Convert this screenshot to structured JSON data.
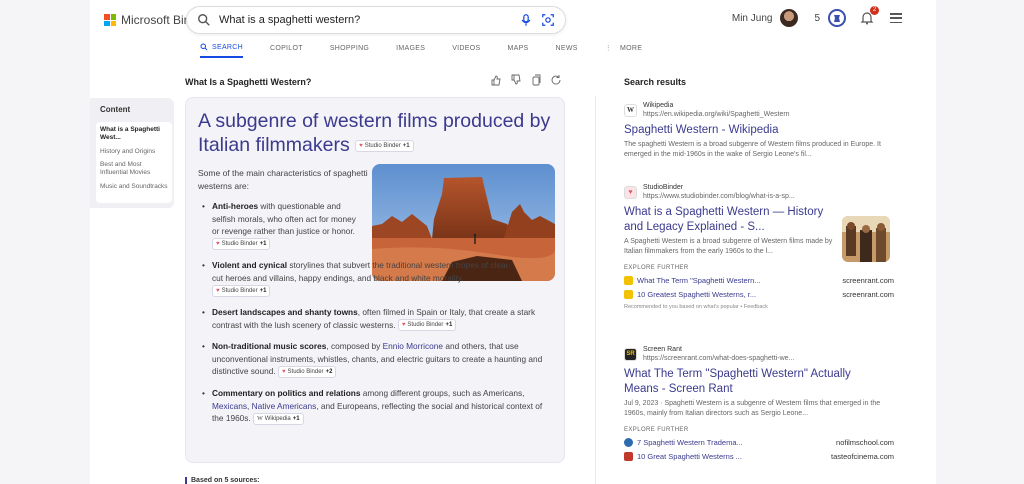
{
  "header": {
    "brand": "Microsoft Bing",
    "search_value": "What is a spaghetti western?",
    "user_name": "Min Jung",
    "reward_count": "5",
    "notification_count": "2",
    "brand_colors": [
      "#f25022",
      "#7fba00",
      "#00a4ef",
      "#ffb900"
    ]
  },
  "tabs": [
    {
      "label": "SEARCH",
      "active": true
    },
    {
      "label": "COPILOT"
    },
    {
      "label": "SHOPPING"
    },
    {
      "label": "IMAGES"
    },
    {
      "label": "VIDEOS"
    },
    {
      "label": "MAPS"
    },
    {
      "label": "NEWS"
    },
    {
      "label": "MORE"
    }
  ],
  "toc": {
    "title": "Content",
    "items": [
      "What is a Spaghetti West...",
      "History and Origins",
      "Best and Most Influential Movies",
      "Music and Soundtracks"
    ]
  },
  "answer": {
    "question": "What Is a Spaghetti Western?",
    "headline": "A subgenre of western films produced by Italian filmmakers",
    "headline_cite": {
      "source": "Studio Binder",
      "extra": "+1"
    },
    "intro": "Some of the main characteristics of spaghetti westerns are:",
    "bullets": [
      {
        "bold": "Anti-heroes",
        "text": " with questionable and selfish morals, who often act for money or revenge rather than justice or honor.",
        "cite_source": "Studio Binder",
        "cite_extra": "+1"
      },
      {
        "bold": "Violent and cynical",
        "text": " storylines that subvert the traditional western tropes of clear-cut heroes and villains, happy endings, and black and white morality.",
        "cite_source": "Studio Binder",
        "cite_extra": "+1"
      },
      {
        "bold": "Desert landscapes and shanty towns",
        "text": ", often filmed in Spain or Italy, that create a stark contrast with the lush scenery of classic westerns.",
        "cite_source": "Studio Binder",
        "cite_extra": "+1"
      },
      {
        "bold": "Non-traditional music scores",
        "text_a": ", composed by ",
        "link": "Ennio Morricone",
        "text_b": " and others, that use unconventional instruments, whistles, chants, and electric guitars to create a haunting and distinctive sound.",
        "cite_source": "Studio Binder",
        "cite_extra": "+2"
      },
      {
        "bold": "Commentary on politics and relations",
        "text_a": " among different groups, such as Americans, ",
        "link1": "Mexicans",
        "sep": ", ",
        "link2": "Native Americans",
        "text_b": ", and Europeans, reflecting the social and historical context of the 1960s.",
        "cite_source": "Wikipedia",
        "cite_extra": "+1"
      }
    ],
    "based_on": "Based on 5 sources:"
  },
  "results": {
    "title": "Search results",
    "items": [
      {
        "site": "Wikipedia",
        "url": "https://en.wikipedia.org/wiki/Spaghetti_Western",
        "title": "Spaghetti Western - Wikipedia",
        "snippet": "The spaghetti Western is a broad subgenre of Western films produced in Europe. It emerged in the mid-1960s in the wake of Sergio Leone's fil..."
      },
      {
        "site": "StudioBinder",
        "url": "https://www.studiobinder.com/blog/what-is-a-sp...",
        "title": "What is a Spaghetti Western — History and Legacy Explained - S...",
        "snippet": "A Spaghetti Western is a broad subgenre of Western films made by Italian filmmakers from the early 1960s to the l...",
        "explore_label": "EXPLORE FURTHER",
        "explore": [
          {
            "text": "What The Term \"Spaghetti Western...",
            "domain": "screenrant.com"
          },
          {
            "text": "10 Greatest Spaghetti Westerns, r...",
            "domain": "screenrant.com"
          }
        ],
        "recommended": "Recommended to you based on what's popular • Feedback"
      },
      {
        "site": "Screen Rant",
        "url": "https://screenrant.com/what-does-spaghetti-we...",
        "title": "What The Term \"Spaghetti Western\" Actually Means - Screen Rant",
        "snippet": "Jul 9, 2023 · Spaghetti Western is a subgenre of Western films that emerged in the 1960s, mainly from Italian directors such as Sergio Leone...",
        "explore_label": "EXPLORE FURTHER",
        "explore": [
          {
            "text": "7 Spaghetti Western Tradema...",
            "domain": "nofilmschool.com"
          },
          {
            "text": "10 Great Spaghetti Westerns ...",
            "domain": "tasteofcinema.com"
          }
        ]
      }
    ]
  }
}
